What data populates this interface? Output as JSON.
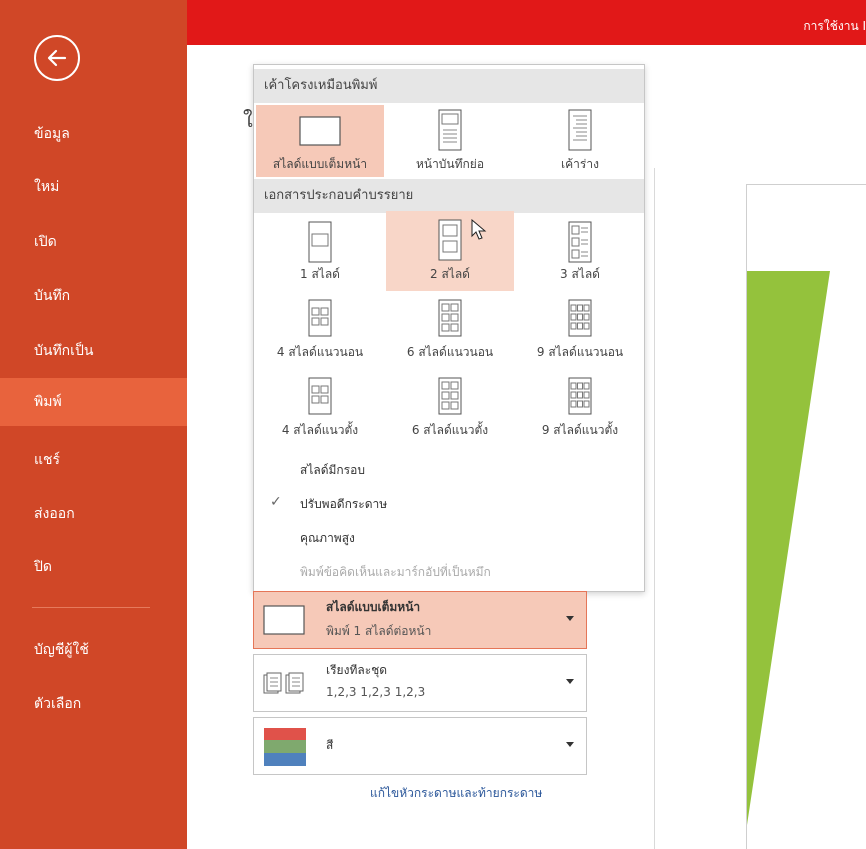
{
  "sidebar": {
    "items": [
      {
        "label": "ข้อมูล"
      },
      {
        "label": "ใหม่"
      },
      {
        "label": "เปิด"
      },
      {
        "label": "บันทึก"
      },
      {
        "label": "บันทึกเป็น"
      },
      {
        "label": "พิมพ์"
      },
      {
        "label": "แชร์"
      },
      {
        "label": "ส่งออก"
      },
      {
        "label": "ปิด"
      },
      {
        "label": "บัญชีผู้ใช้"
      },
      {
        "label": "ตัวเลือก"
      }
    ],
    "active_index": 5
  },
  "topbar": {
    "text": "การใช้งาน I"
  },
  "main": {
    "truncated_char": "ใ"
  },
  "panel": {
    "section_layout": "เค้าโครงเหมือนพิมพ์",
    "layout_options": [
      {
        "label": "สไลด์แบบเต็มหน้า"
      },
      {
        "label": "หน้าบันทึกย่อ"
      },
      {
        "label": "เค้าร่าง"
      }
    ],
    "section_handouts": "เอกสารประกอบคำบรรยาย",
    "handout_options": [
      {
        "label": "1 สไลด์"
      },
      {
        "label": "2 สไลด์"
      },
      {
        "label": "3 สไลด์"
      },
      {
        "label": "4 สไลด์แนวนอน"
      },
      {
        "label": "6 สไลด์แนวนอน"
      },
      {
        "label": "9 สไลด์แนวนอน"
      },
      {
        "label": "4 สไลด์แนวตั้ง"
      },
      {
        "label": "6 สไลด์แนวตั้ง"
      },
      {
        "label": "9 สไลด์แนวตั้ง"
      }
    ],
    "menu": [
      {
        "label": "สไลด์มีกรอบ"
      },
      {
        "label": "ปรับพอดีกระดาษ"
      },
      {
        "label": "คุณภาพสูง"
      },
      {
        "label": "พิมพ์ข้อคิดเห็นและมาร์กอัปที่เป็นหมึก"
      }
    ],
    "check_mark": "✓"
  },
  "settings": {
    "layout": {
      "title": "สไลด์แบบเต็มหน้า",
      "subtitle": "พิมพ์ 1 สไลด์ต่อหน้า"
    },
    "collate": {
      "title": "เรียงทีละชุด",
      "subtitle": "1,2,3    1,2,3    1,2,3"
    },
    "color": {
      "title": "สี"
    }
  },
  "footer": {
    "link": "แก้ไขหัวกระดาษและท้ายกระดาษ"
  },
  "colors": {
    "sidebar": "#d04727",
    "sidebar_active": "#e8633d",
    "topbar": "#e11818",
    "selected": "#f6c9b8",
    "preview_green": "#94c23c"
  }
}
